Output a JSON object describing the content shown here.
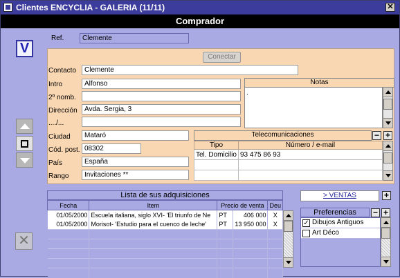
{
  "window": {
    "title": "Clientes ENCYCLIA - GALERIA (11/11)",
    "close_glyph": "✕"
  },
  "header": {
    "title": "Comprador"
  },
  "nav": {
    "v_label": "V",
    "delete_glyph": "✕"
  },
  "form": {
    "ref_label": "Ref.",
    "ref_value": "Clemente",
    "connect_label": "Conectar",
    "contacto_label": "Contacto",
    "contacto_value": "Clemente",
    "intro_label": "Intro",
    "intro_value": "Alfonso",
    "nomb2_label": "2º nomb.",
    "nomb2_value": "",
    "direccion_label": "Dirección",
    "direccion_value": "Avda. Sergia, 3",
    "direccion2_label": "..../...",
    "direccion2_value": "",
    "ciudad_label": "Ciudad",
    "ciudad_value": "Mataró",
    "cp_label": "Cód. post.",
    "cp_value": "08302",
    "pais_label": "País",
    "pais_value": "España",
    "rango_label": "Rango",
    "rango_value": "Invitaciones **"
  },
  "notes": {
    "title": "Notas",
    "value": "."
  },
  "telecom": {
    "title": "Telecomunicaciones",
    "remove_glyph": "−",
    "add_glyph": "+",
    "columns": [
      "Tipo",
      "Número / e-mail"
    ],
    "rows": [
      [
        "Tel. Domicilio",
        "93 475 86 93"
      ]
    ]
  },
  "purchases": {
    "title": "Lista de sus adquisiciones",
    "columns": [
      "Fecha",
      "Item",
      "Precio de venta",
      "Deu"
    ],
    "rows": [
      [
        "01/05/2000",
        "Escuela italiana, siglo XVI- 'El triunfo de Ne",
        "PT",
        "406 000",
        "X"
      ],
      [
        "01/05/2000",
        "Morisot- 'Estudio para el cuenco de leche'",
        "PT",
        "13 950 000",
        "X"
      ]
    ]
  },
  "ventas": {
    "label": "> VENTAS",
    "add_glyph": "+"
  },
  "preferences": {
    "title": "Preferencias",
    "remove_glyph": "−",
    "add_glyph": "+",
    "items": [
      {
        "label": "Dibujos Antiguos",
        "checked": "✓"
      },
      {
        "label": "Art Déco",
        "checked": ""
      }
    ]
  }
}
